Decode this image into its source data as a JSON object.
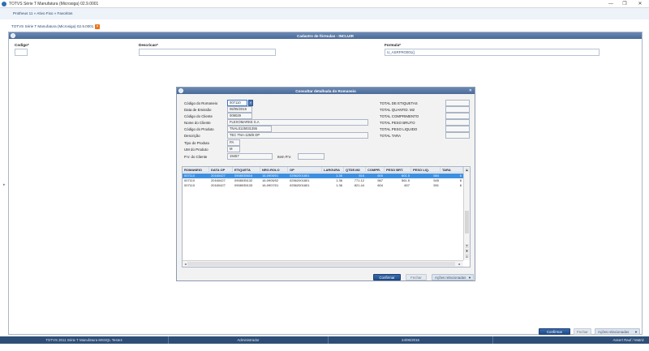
{
  "window": {
    "title": "TOTVS Série T Manufatura (Microsiga) 02.9.0001",
    "min": "—",
    "max": "❐",
    "close": "✕"
  },
  "breadcrumb": "Protheus 11 » Ativo Fixo » Favoritos",
  "tab": {
    "label": "TOTVS Série T Manufatura (Microsiga) 02.9.0001",
    "close": "×"
  },
  "main": {
    "title": "Cadastro de fórmulas - INCLUIR",
    "fields": {
      "codigo_label": "Codigo*",
      "codigo_value": "",
      "descricao_label": "Descricao*",
      "descricao_value": "",
      "formula_label": "Formula*",
      "formula_value": "U_ASRFRO001()"
    },
    "buttons": {
      "confirmar": "Confirmar",
      "fechar": "Fechar",
      "acoes": "Ações relacionadas"
    }
  },
  "modal": {
    "title": "Consultar detalhada do Romaneio",
    "close": "✕",
    "left": [
      {
        "label": "Código do Romaneio",
        "value": "007110"
      },
      {
        "label": "Data de Emissão",
        "value": "06/05/2016"
      },
      {
        "label": "Código do Cliente",
        "value": "009029"
      },
      {
        "label": "Nome do Cliente",
        "value": "FLEXOMARKE S.A"
      },
      {
        "label": "Código do Produto",
        "value": "TNAL0125031355"
      },
      {
        "label": "Descrição",
        "value": "TEC TNA-125/B DP"
      },
      {
        "label": "Tipo do Produto",
        "value": "PA"
      },
      {
        "label": "UM do Produto",
        "value": "M"
      },
      {
        "label": "P.V. do Cliente",
        "value": "19457"
      }
    ],
    "item_pv": {
      "label": "Item P.V.",
      "value": ""
    },
    "right": [
      {
        "label": "TOTAL DE ETIQUETAS",
        "value": ""
      },
      {
        "label": "TOTAL QUANTID. M2",
        "value": ""
      },
      {
        "label": "TOTAL COMPRIMENTO",
        "value": ""
      },
      {
        "label": "TOTAL PESO BRUTO",
        "value": ""
      },
      {
        "label": "TOTAL PESO LIQUIDO",
        "value": ""
      },
      {
        "label": "TOTAL TARA",
        "value": ""
      }
    ],
    "grid": {
      "columns": [
        "ROMANEIO",
        "DATA OP",
        "ETIQUETA",
        "NRO.ROLO",
        "OP",
        "LARGURA",
        "QTDE.M2",
        "COMPR.",
        "PESO BRT.",
        "PESO LIQ.",
        "TARA"
      ],
      "rows": [
        [
          "007110",
          "20160427",
          "0908035616",
          "16-0905/01",
          "02562001801",
          "1.36",
          "816",
          "600",
          "601.5",
          "",
          "584",
          "6"
        ],
        [
          "007110",
          "20160427",
          "0908035132",
          "16-0905/02",
          "02562001801",
          "1.36",
          "771.12",
          "567",
          "561.5",
          "",
          "545",
          "6"
        ],
        [
          "007110",
          "20160427",
          "0908035133",
          "16-0907/01",
          "02562001801",
          "1.36",
          "821.44",
          "604",
          "607",
          "",
          "591",
          "6"
        ]
      ]
    },
    "buttons": {
      "confirmar": "Confirmar",
      "fechar": "Fechar",
      "acoes": "Ações relacionadas"
    }
  },
  "status": {
    "segments": [
      "TOTVS 2011 Série T Manufatura MSSQL Teste4",
      "Administrador",
      "24/05/2016",
      "Assert Rauf / Matriz"
    ]
  },
  "colors": {
    "header": "#4a6a98",
    "selection": "#3d8fe0",
    "status": "#2e4e77",
    "primary_button": "#1f4f8f"
  }
}
